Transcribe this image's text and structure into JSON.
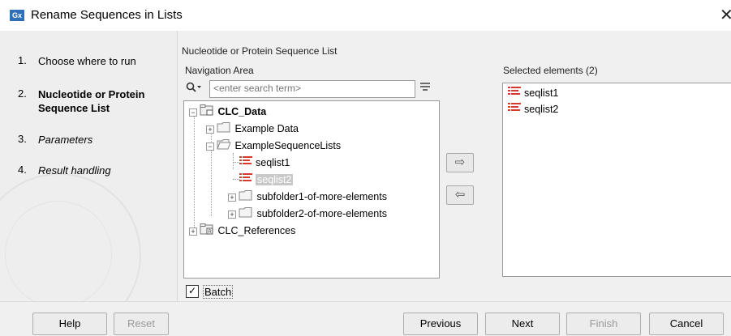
{
  "window": {
    "title": "Rename Sequences in Lists",
    "app_icon": "Gx"
  },
  "steps": [
    {
      "num": "1.",
      "label": "Choose where to run",
      "state": "done"
    },
    {
      "num": "2.",
      "label": "Nucleotide or Protein Sequence List",
      "state": "active"
    },
    {
      "num": "3.",
      "label": "Parameters",
      "state": "future"
    },
    {
      "num": "4.",
      "label": "Result handling",
      "state": "future"
    }
  ],
  "section_title": "Nucleotide or Protein Sequence List",
  "navigation": {
    "label": "Navigation Area",
    "search_placeholder": "<enter search term>",
    "tree": [
      {
        "label": "CLC_Data",
        "icon": "database-folder-icon",
        "bold": true
      },
      {
        "label": "Example Data",
        "icon": "folder-icon"
      },
      {
        "label": "ExampleSequenceLists",
        "icon": "folder-open-icon"
      },
      {
        "label": "seqlist1",
        "icon": "sequence-list-icon"
      },
      {
        "label": "seqlist2",
        "icon": "sequence-list-icon",
        "selected": true
      },
      {
        "label": "subfolder1-of-more-elements",
        "icon": "folder-icon"
      },
      {
        "label": "subfolder2-of-more-elements",
        "icon": "folder-icon"
      },
      {
        "label": "CLC_References",
        "icon": "reference-folder-icon"
      }
    ]
  },
  "selected": {
    "label": "Selected elements (2)",
    "items": [
      {
        "label": "seqlist1"
      },
      {
        "label": "seqlist2"
      }
    ]
  },
  "batch": {
    "label": "Batch",
    "checked": true,
    "check_glyph": "✓"
  },
  "buttons": {
    "help": "Help",
    "reset": "Reset",
    "previous": "Previous",
    "next": "Next",
    "finish": "Finish",
    "cancel": "Cancel"
  },
  "colors": {
    "sequence_icon": "#d43a2e",
    "app_icon": "#2f6fb7"
  }
}
